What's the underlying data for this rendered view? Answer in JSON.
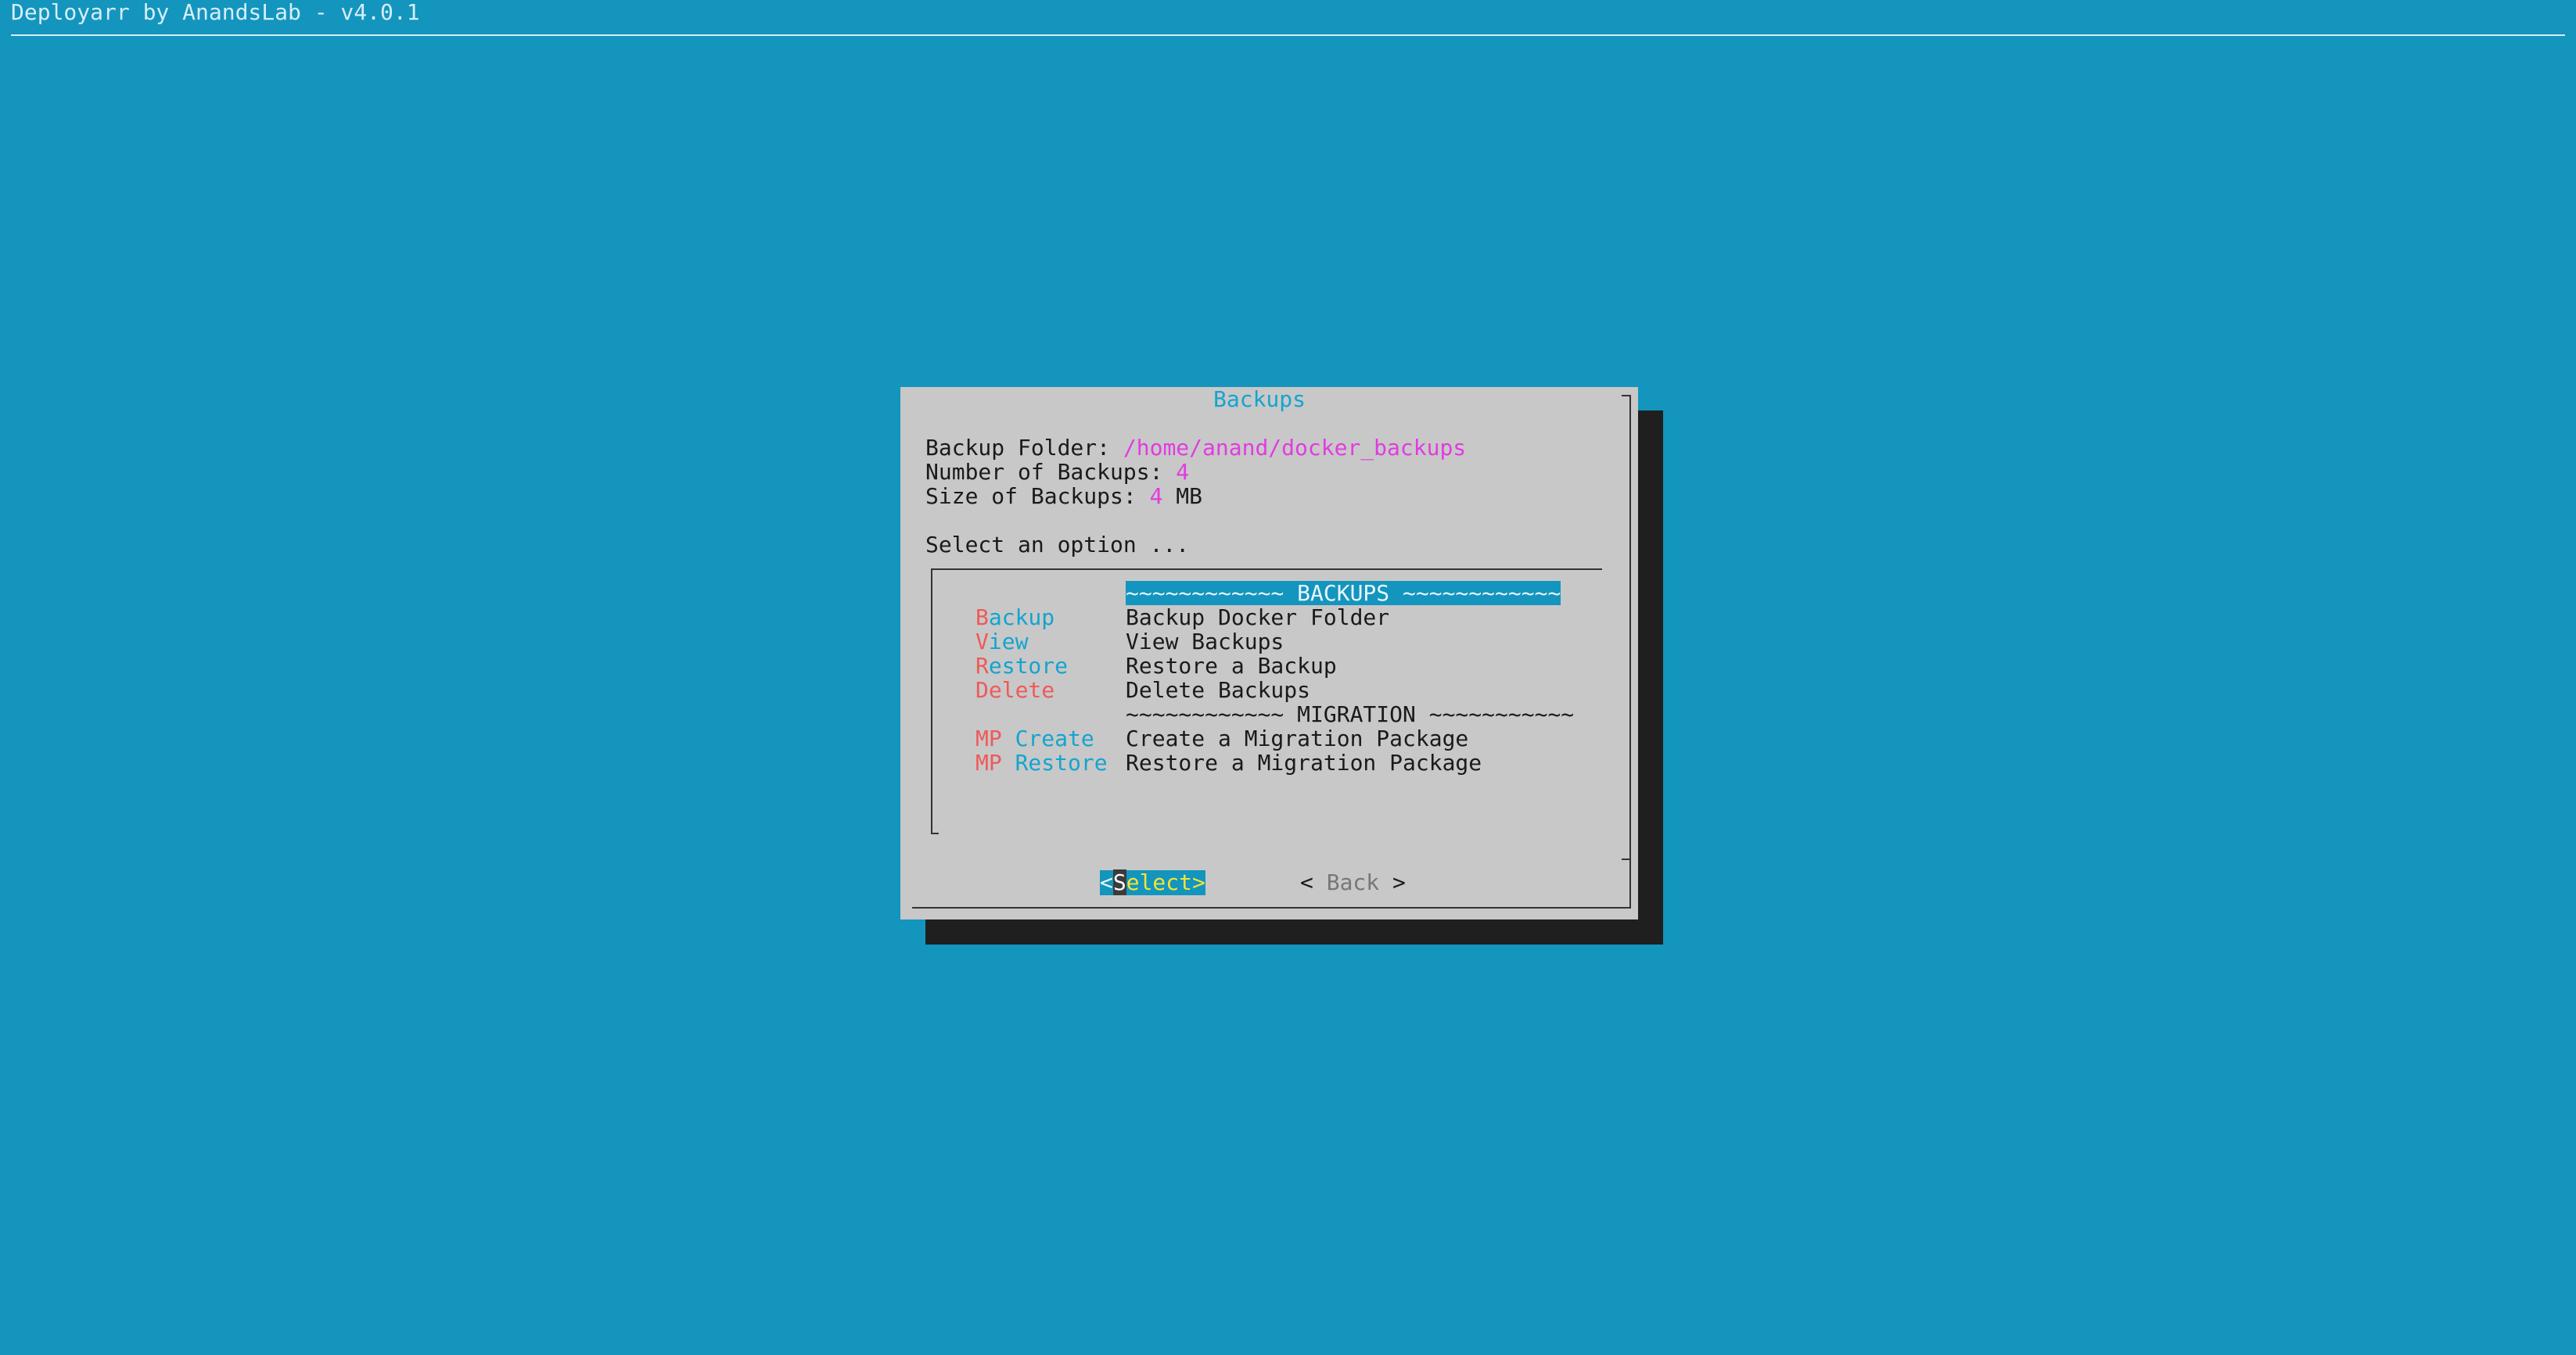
{
  "app": {
    "title": "Deployarr by AnandsLab - v4.0.1"
  },
  "dialog": {
    "title": "Backups",
    "info": {
      "folder_label": "Backup Folder: ",
      "folder_value": "/home/anand/docker_backups",
      "count_label": "Number of Backups: ",
      "count_value": "4",
      "size_label": "Size of Backups: ",
      "size_value": "4",
      "size_unit": " MB"
    },
    "prompt": "Select an option ...",
    "menu": {
      "header_backups": "~~~~~~~~~~~~ BACKUPS ~~~~~~~~~~~~",
      "header_migration": "~~~~~~~~~~~~ MIGRATION ~~~~~~~~~~~",
      "items": [
        {
          "key_hot": "B",
          "key_rest": "ackup",
          "desc": "Backup Docker Folder"
        },
        {
          "key_hot": "V",
          "key_rest": "iew",
          "desc": "View Backups"
        },
        {
          "key_hot": "R",
          "key_rest": "estore",
          "desc": "Restore a Backup"
        },
        {
          "key_hot": "D",
          "key_rest": "elete",
          "desc": "Delete Backups"
        },
        {
          "key_hot": "MP",
          "key_rest": " Create",
          "desc": "Create a Migration Package"
        },
        {
          "key_hot": "MP",
          "key_rest": " Restore",
          "desc": "Restore a Migration Package"
        }
      ]
    },
    "buttons": {
      "select_open": "<",
      "select_hot": "S",
      "select_rest": "elect>",
      "back": "< Back >"
    }
  },
  "colors": {
    "background": "#1395BE",
    "dialog": "#c8c8c8",
    "shadow": "#1f1f1f",
    "title": "#14A4CF",
    "value": "#E13CE0",
    "hotkey": "#EE5A5A",
    "menu_key": "#14A4CF",
    "button_highlight": "#F4E336"
  }
}
